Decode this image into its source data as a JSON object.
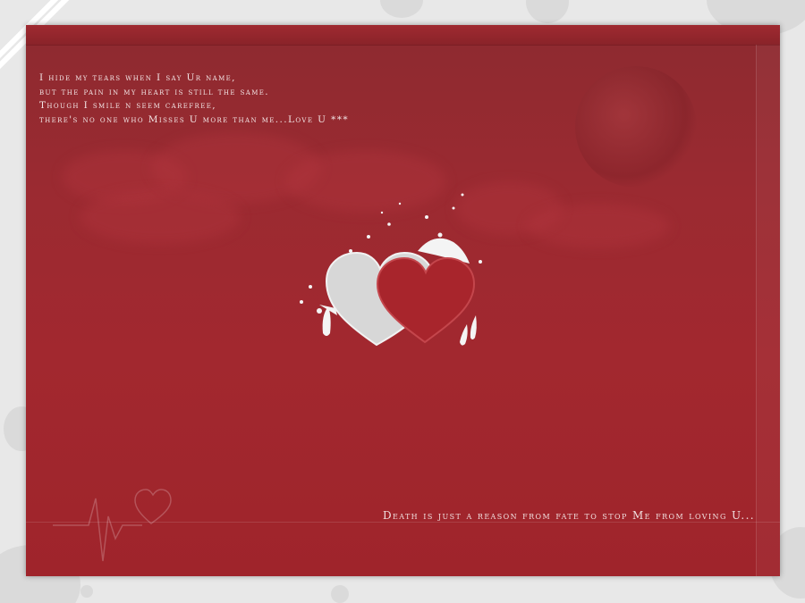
{
  "poem": {
    "lines": [
      "I hide my tears when I say Ur name,",
      "but the pain in my heart is still the same.",
      "Though I smile n seem carefree,",
      "there's no one who Misses U more than me...Love U ***"
    ]
  },
  "tagline": "Death is just a reason from fate to stop Me from loving U...",
  "colors": {
    "card_red": "#9b2a31",
    "heart_red": "#a8252c",
    "heart_grey": "#d9d9d9",
    "text": "#f3e5e5"
  },
  "icons": [
    "heart-icon",
    "heartbeat-icon"
  ]
}
